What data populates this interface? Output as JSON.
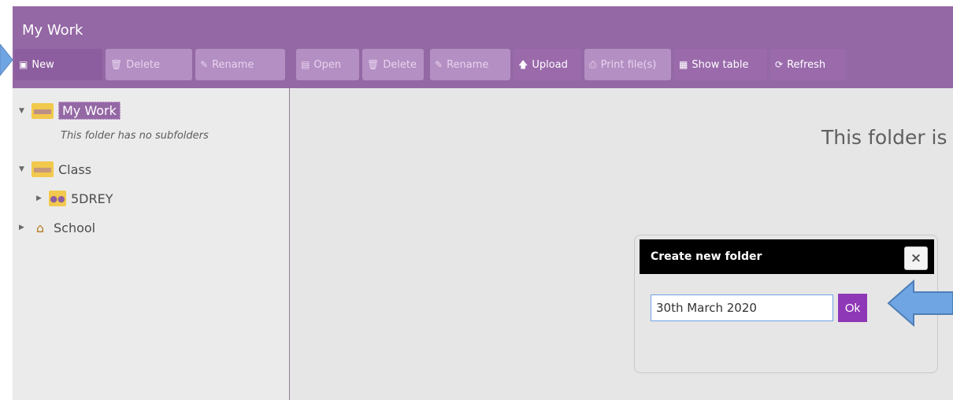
{
  "window": {
    "title": "My Work"
  },
  "toolbar_left": [
    {
      "label": "New",
      "icon": "new-folder-icon",
      "state": "active"
    },
    {
      "label": "Delete",
      "icon": "trash-icon",
      "state": "disabled"
    },
    {
      "label": "Rename",
      "icon": "pencil-icon",
      "state": "disabled"
    }
  ],
  "toolbar_right": [
    {
      "label": "Open",
      "icon": "file-icon",
      "state": "disabled"
    },
    {
      "label": "Delete",
      "icon": "trash-icon",
      "state": "disabled"
    },
    {
      "label": "Rename",
      "icon": "pencil-icon",
      "state": "disabled"
    },
    {
      "label": "Upload",
      "icon": "upload-arrow-icon",
      "state": "enabled"
    },
    {
      "label": "Print file(s)",
      "icon": "printer-icon",
      "state": "disabled"
    },
    {
      "label": "Show table",
      "icon": "table-grid-icon",
      "state": "enabled"
    },
    {
      "label": "Refresh",
      "icon": "refresh-icon",
      "state": "enabled"
    }
  ],
  "tree": {
    "my_work": "My Work",
    "no_subfolders": "This folder has no subfolders",
    "class": "Class",
    "group": "5DREY",
    "school": "School"
  },
  "main": {
    "empty_message": "This folder is"
  },
  "dialog": {
    "title": "Create new folder",
    "close_label": "×",
    "input_value": "30th March 2020",
    "ok_label": "Ok"
  },
  "colors": {
    "accent_purple": "#9468a4",
    "ok_button": "#8f38b7",
    "callout_arrow": "#6fa5e2"
  }
}
